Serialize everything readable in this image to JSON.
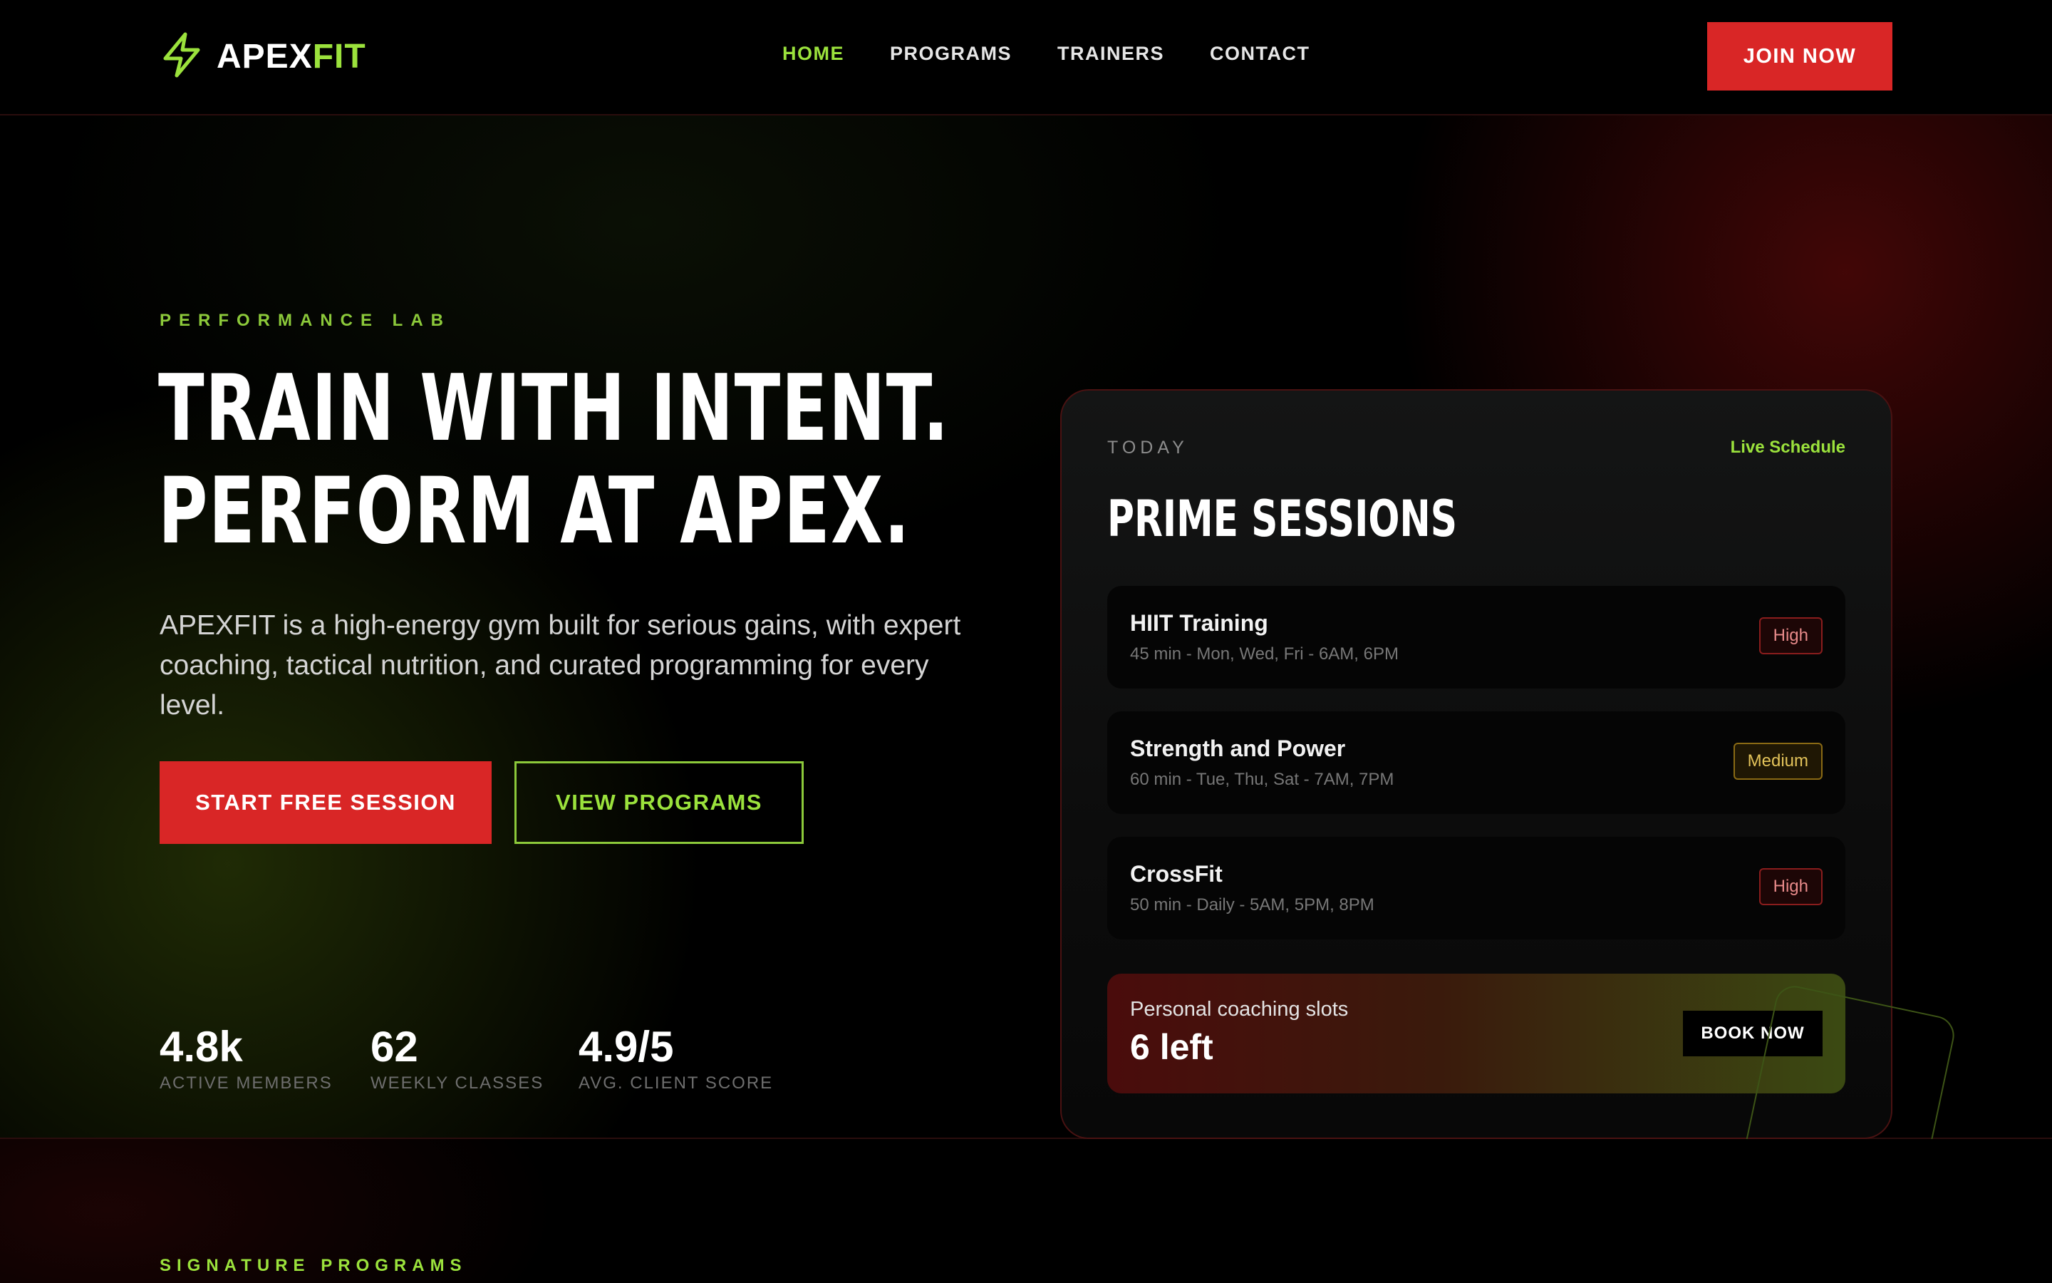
{
  "brand": {
    "name_part1": "APEX",
    "name_part2": "FIT",
    "icon": "lightning-bolt-icon",
    "accent_green": "#9be23c",
    "accent_red": "#d92626"
  },
  "nav": {
    "links": [
      {
        "label": "HOME",
        "active": true
      },
      {
        "label": "PROGRAMS",
        "active": false
      },
      {
        "label": "TRAINERS",
        "active": false
      },
      {
        "label": "CONTACT",
        "active": false
      }
    ],
    "cta": "JOIN NOW"
  },
  "hero": {
    "eyebrow": "PERFORMANCE LAB",
    "headline_line1": "TRAIN WITH INTENT.",
    "headline_line2": "PERFORM AT APEX.",
    "lede": "APEXFIT is a high-energy gym built for serious gains, with expert coaching, tactical nutrition, and curated programming for every level.",
    "primary_cta": "START FREE SESSION",
    "secondary_cta": "VIEW PROGRAMS",
    "stats": [
      {
        "value": "4.8k",
        "label": "ACTIVE MEMBERS"
      },
      {
        "value": "62",
        "label": "WEEKLY CLASSES"
      },
      {
        "value": "4.9/5",
        "label": "AVG. CLIENT SCORE"
      }
    ]
  },
  "schedule": {
    "eyebrow": "TODAY",
    "live_label": "Live Schedule",
    "title": "PRIME SESSIONS",
    "sessions": [
      {
        "name": "HIIT Training",
        "meta": "45 min - Mon, Wed, Fri - 6AM, 6PM",
        "intensity": "High"
      },
      {
        "name": "Strength and Power",
        "meta": "60 min - Tue, Thu, Sat - 7AM, 7PM",
        "intensity": "Medium"
      },
      {
        "name": "CrossFit",
        "meta": "50 min - Daily - 5AM, 5PM, 8PM",
        "intensity": "High"
      }
    ],
    "coaching": {
      "label": "Personal coaching slots",
      "value": "6 left",
      "cta": "BOOK NOW"
    }
  },
  "programs": {
    "eyebrow": "SIGNATURE PROGRAMS"
  }
}
